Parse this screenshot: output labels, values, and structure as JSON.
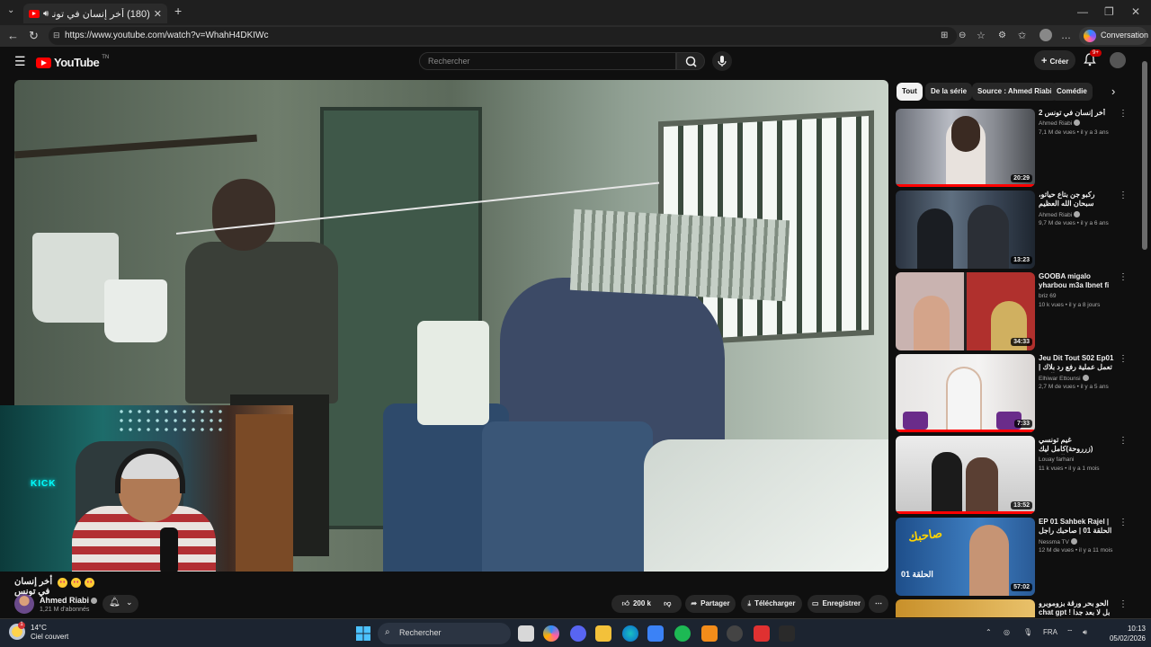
{
  "browser": {
    "tab_title": "(180) أخر إنسان في تونس 😂 😂 😂",
    "url": "https://www.youtube.com/watch?v=WhahH4DKIWc",
    "conversation_label": "Conversation"
  },
  "header": {
    "logo_text": "YouTube",
    "logo_region": "TN",
    "search_placeholder": "Rechercher",
    "create_label": "Créer",
    "notifications_badge": "9+"
  },
  "video": {
    "title": "أخر إنسان في تونس",
    "channel_name": "Ahmed Riabi",
    "subscribers": "1,21 M d'abonnés",
    "webcam_sign": "KICK",
    "actions": {
      "likes": "200 k",
      "share": "Partager",
      "download": "Télécharger",
      "save": "Enregistrer"
    }
  },
  "chips": [
    "Tout",
    "De la série",
    "Source : Ahmed Riabi",
    "Comédie"
  ],
  "recommendations": [
    {
      "title": "أخر إنسان في تونس 2",
      "channel": "Ahmed Riabi",
      "meta": "7,1 M de vues • il y a 3 ans",
      "duration": "20:29",
      "verified": true,
      "progress": 1.0
    },
    {
      "title": "ركبو جن بتاع حياتو، سبحان الله العظيم",
      "channel": "Ahmed Riabi",
      "meta": "9,7 M de vues • il y a 6 ans",
      "duration": "13:23",
      "verified": true,
      "progress": 0
    },
    {
      "title": "GOOBA migalo yharbou m3a Ibnet fi live Azar ...",
      "channel": "briz 69",
      "meta": "10 k vues • il y a 8 jours",
      "duration": "34:33",
      "verified": false,
      "progress": 0
    },
    {
      "title": "Jeu Dit Tout S02 Ep01 | تعمل عملية رفع رد بلاك (الجزء ...",
      "channel": "Elhiwar Ettounsi",
      "meta": "2,7 M de vues • il y a 5 ans",
      "duration": "7:33",
      "verified": true,
      "progress": 1.0
    },
    {
      "title": "غيم تونسي (زرروحة)كامل ليك الفرحاني",
      "channel": "Louay farhani",
      "meta": "11 k vues • il y a 1 mois",
      "duration": "13:52",
      "verified": false,
      "progress": 1.0
    },
    {
      "title": "EP 01 Sahbek Rajel | الحلقة 01 | صاحبك راجل | Offert p...",
      "channel": "Nessma TV",
      "meta": "12 M de vues • il y a 11 mois",
      "duration": "57:02",
      "verified": true,
      "progress": 0
    },
    {
      "title": "الحو بحر ورقة بزوموبرو بل لا بعد جدا ! chat gpt",
      "channel": "",
      "meta": "",
      "duration": "",
      "verified": false,
      "progress": 0
    }
  ],
  "taskbar": {
    "temperature": "14°C",
    "weather": "Ciel couvert",
    "weather_badge": "1",
    "search_label": "Rechercher",
    "language": "FRA",
    "time": "10:13",
    "date": "05/02/2026"
  }
}
